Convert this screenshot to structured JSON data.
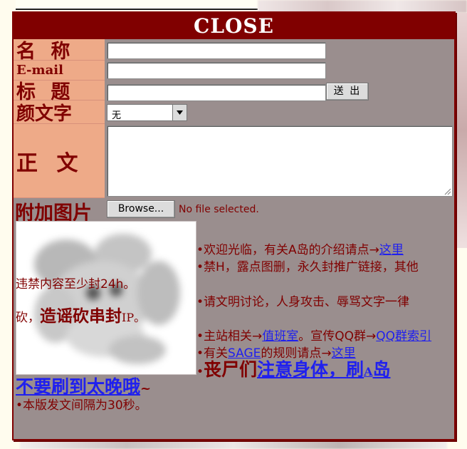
{
  "modal": {
    "close_label": "CLOSE"
  },
  "form": {
    "name_label": "名 称",
    "email_label": "E-mail",
    "title_label": "标 题",
    "kaomoji_label": "颜文字",
    "body_label": "正 文",
    "attach_label": "附加图片",
    "name_value": "",
    "email_value": "",
    "title_value": "",
    "send_label": "送 出",
    "kaomoji_selected": "无",
    "body_value": "",
    "browse_label": "Browse...",
    "file_status": "No file selected."
  },
  "notices": {
    "welcome_text": "•欢迎光临，有关A岛的介绍请点→",
    "welcome_link": "这里",
    "ban_line1": "•禁H，露点图删，永久封推广链接，其他",
    "ban_line2": "违禁内容至少封24h。",
    "civil_line1": "•请文明讨论，人身攻击、辱骂文字一律",
    "civil_prefix": "砍，",
    "civil_big": "造谣砍串封",
    "civil_suffix": "IP。",
    "mainsite_text": "•主站相关→",
    "mainsite_link": "值班室",
    "qq_text": "。宣传QQ群→",
    "qq_link": "QQ群索引",
    "sage_prefix": "•有关",
    "sage_link": "SAGE",
    "sage_middle": "的规则请点→",
    "sage_link2": "这里",
    "health_bullet": "•",
    "health_red": "丧尸们",
    "health_blue": "注意身体，刷",
    "health_small": "A",
    "health_blue2": "岛",
    "health_line2": "不要刷到太晚哦",
    "health_tilde": "~",
    "interval": "•本版发文间隔为30秒。"
  },
  "colors": {
    "header_bg": "#800000",
    "label_bg": "#eeaa88",
    "panel_bg": "#9a8e8e",
    "text_red": "#800000",
    "link_blue": "#2020ee"
  }
}
